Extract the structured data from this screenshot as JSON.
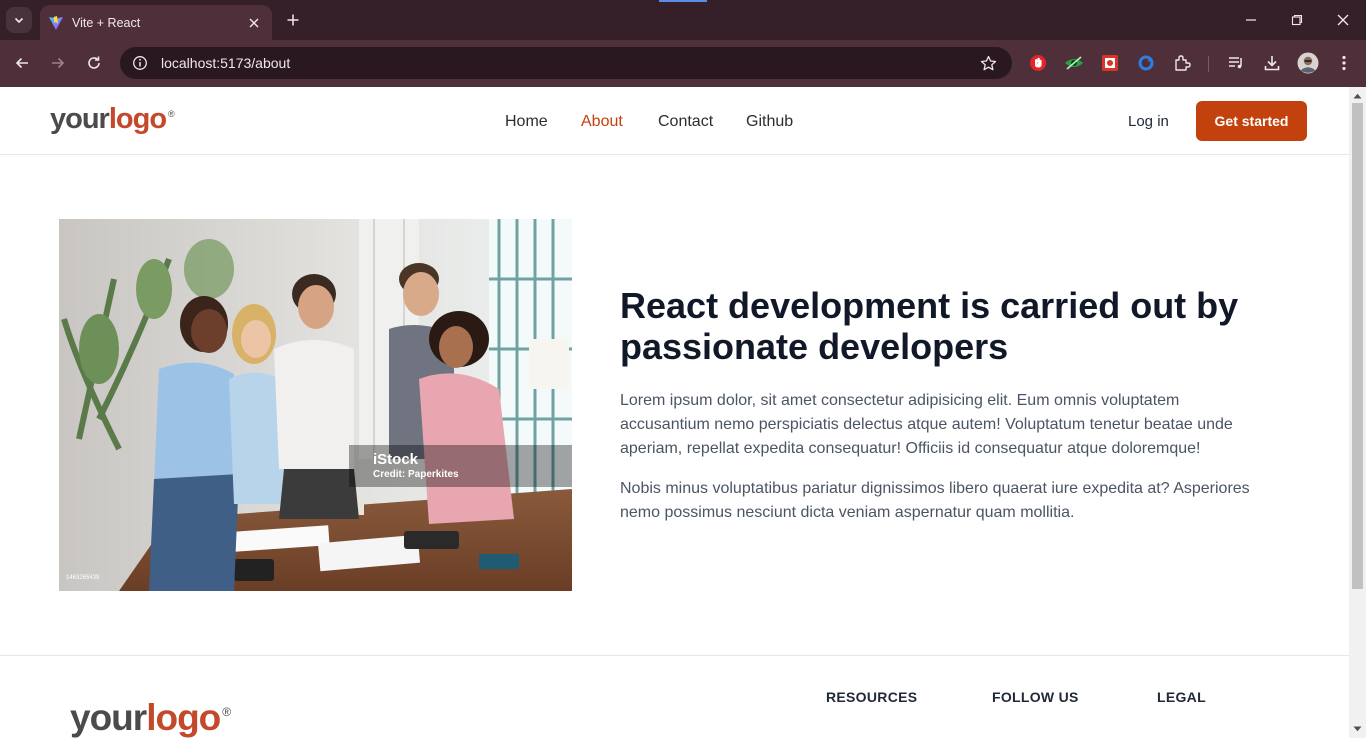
{
  "browser": {
    "tab_title": "Vite + React",
    "url": "localhost:5173/about"
  },
  "site": {
    "logo": {
      "word1": "your",
      "word2": "logo",
      "mark": "®"
    },
    "nav": [
      {
        "label": "Home"
      },
      {
        "label": "About"
      },
      {
        "label": "Contact"
      },
      {
        "label": "Github"
      }
    ],
    "active_nav": "About",
    "login_label": "Log in",
    "cta_label": "Get started"
  },
  "about": {
    "headline": "React development is carried out by passionate developers",
    "paragraph1": "Lorem ipsum dolor, sit amet consectetur adipisicing elit. Eum omnis voluptatem accusantium nemo perspiciatis delectus atque autem! Voluptatum tenetur beatae unde aperiam, repellat expedita consequatur! Officiis id consequatur atque doloremque!",
    "paragraph2": "Nobis minus voluptatibus pariatur dignissimos libero quaerat iure expedita at? Asperiores nemo possimus nesciunt dicta veniam aspernatur quam mollitia.",
    "image_watermark": "iStock",
    "image_credit": "Credit: Paperkites",
    "image_id": "1463265439"
  },
  "footer": {
    "headings": [
      "RESOURCES",
      "FOLLOW US",
      "LEGAL"
    ]
  },
  "colors": {
    "accent": "#c2410c",
    "chrome_dark": "#35202a",
    "chrome_mid": "#4f303a"
  }
}
